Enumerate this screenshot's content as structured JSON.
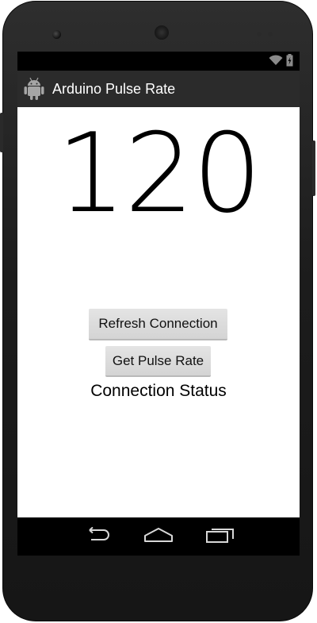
{
  "status_bar": {
    "icons": [
      "wifi-icon",
      "battery-icon"
    ]
  },
  "action_bar": {
    "icon": "android-icon",
    "title": "Arduino Pulse Rate"
  },
  "main": {
    "pulse_rate": "120",
    "refresh_button_label": "Refresh Connection",
    "pulse_button_label": "Get Pulse Rate",
    "connection_status": "Connection Status"
  },
  "nav_bar": {
    "icons": [
      "back-icon",
      "home-icon",
      "recent-apps-icon"
    ]
  },
  "colors": {
    "action_bar": "#2b2b2b",
    "button": "#d6d6d6",
    "phone_body": "#1e1e1e"
  }
}
